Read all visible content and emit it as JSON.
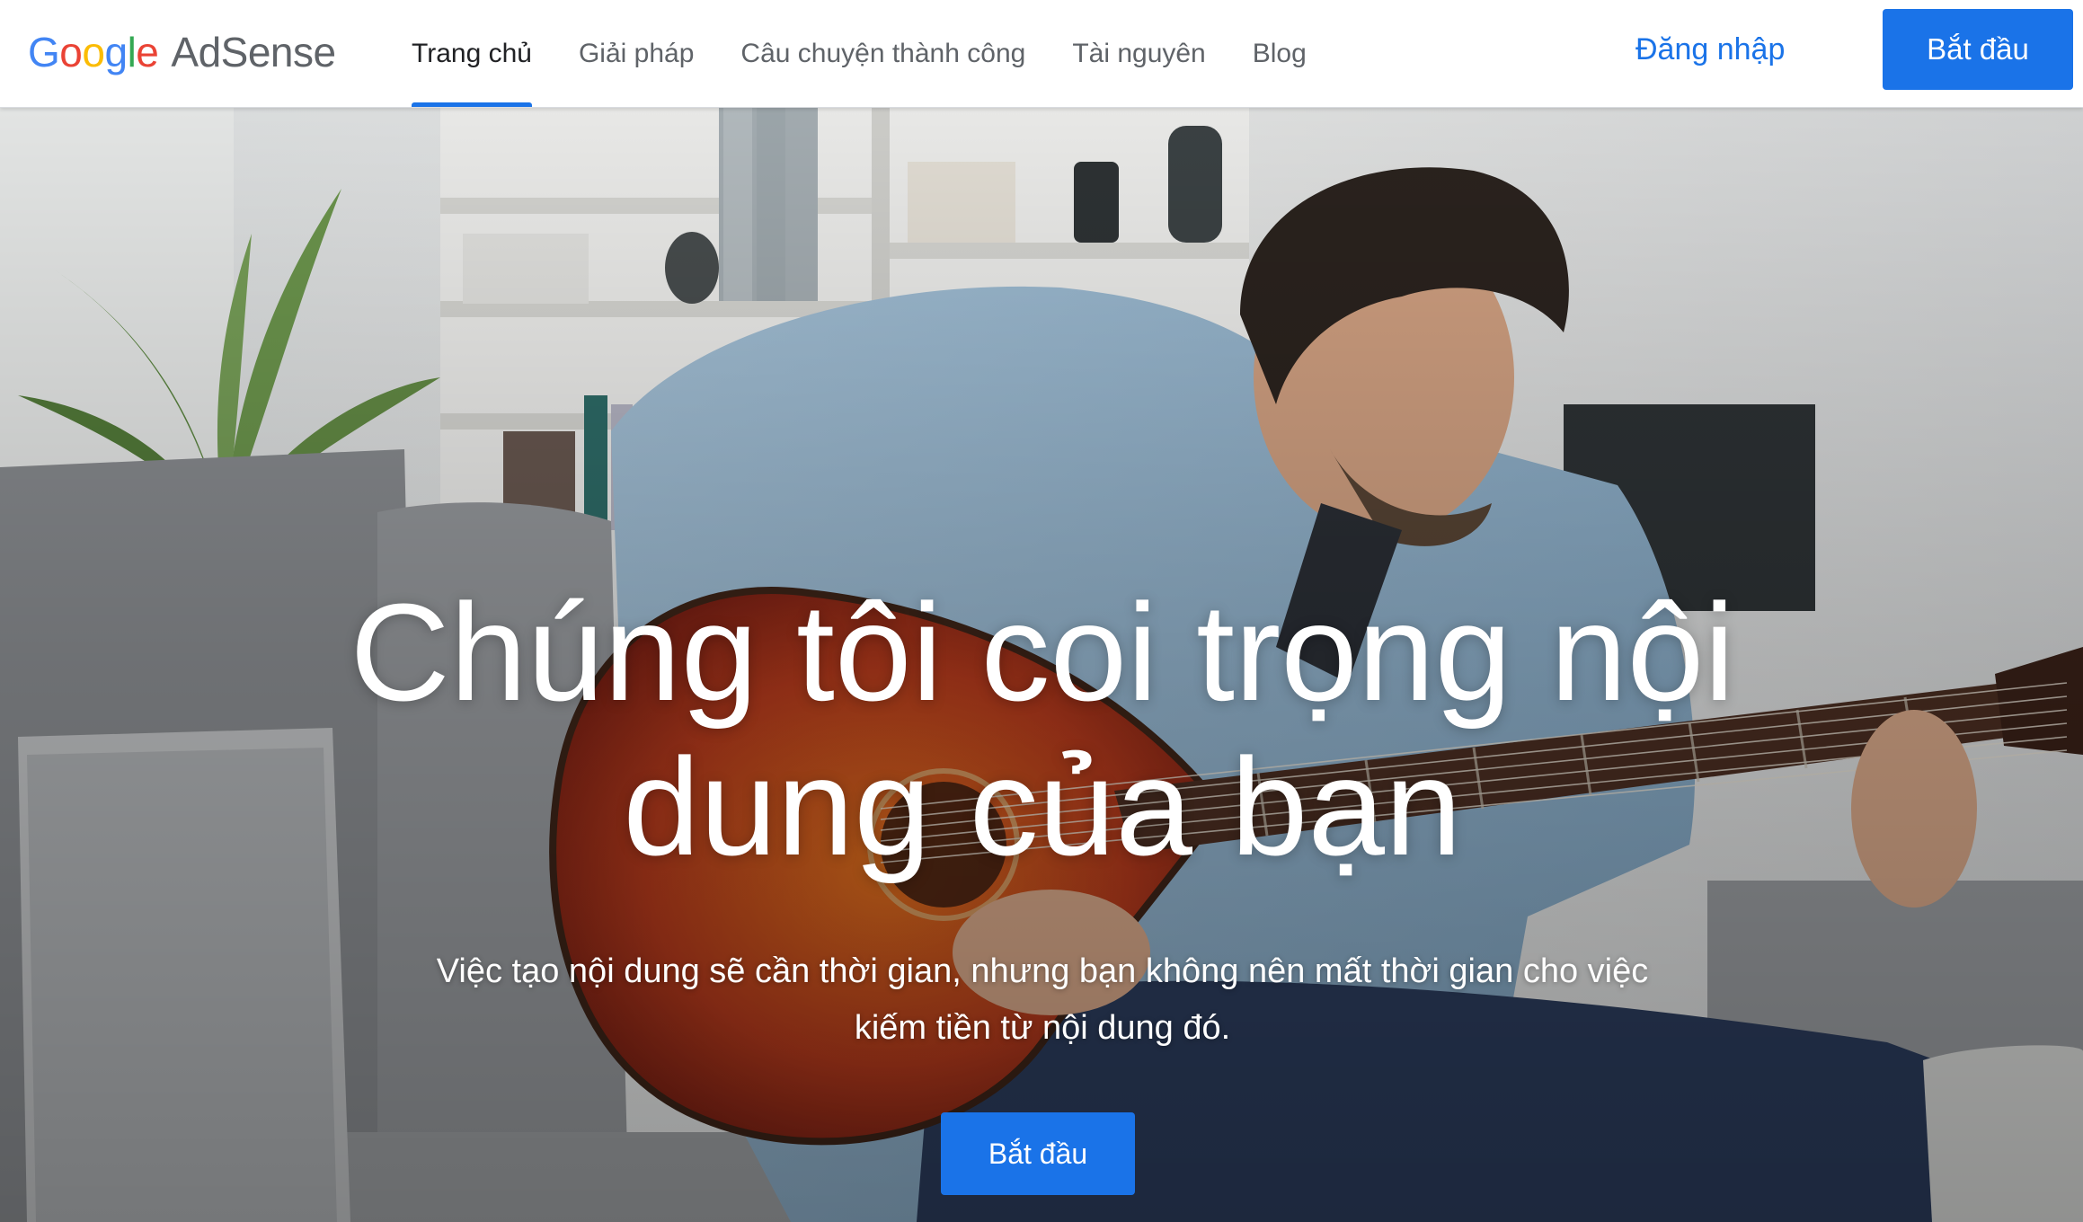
{
  "brand": {
    "logo_letters": [
      "G",
      "o",
      "o",
      "g",
      "l",
      "e"
    ],
    "logo_colors": [
      "#4285F4",
      "#EA4335",
      "#FBBC05",
      "#4285F4",
      "#34A853",
      "#EA4335"
    ],
    "product": "AdSense"
  },
  "nav": {
    "items": [
      {
        "label": "Trang chủ",
        "active": true
      },
      {
        "label": "Giải pháp",
        "active": false
      },
      {
        "label": "Câu chuyện thành công",
        "active": false
      },
      {
        "label": "Tài nguyên",
        "active": false
      },
      {
        "label": "Blog",
        "active": false
      }
    ],
    "signin_label": "Đăng nhập",
    "start_label": "Bắt đầu"
  },
  "hero": {
    "title_line1": "Chúng tôi coi trọng nội",
    "title_line2": "dung của bạn",
    "subtitle_line1": "Việc tạo nội dung sẽ cần thời gian, nhưng bạn không nên mất thời gian cho việc",
    "subtitle_line2": "kiếm tiền từ nội dung đó.",
    "cta_label": "Bắt đầu"
  },
  "colors": {
    "accent": "#1a73e8",
    "nav_text": "#5f6368",
    "nav_active_text": "#202124"
  }
}
